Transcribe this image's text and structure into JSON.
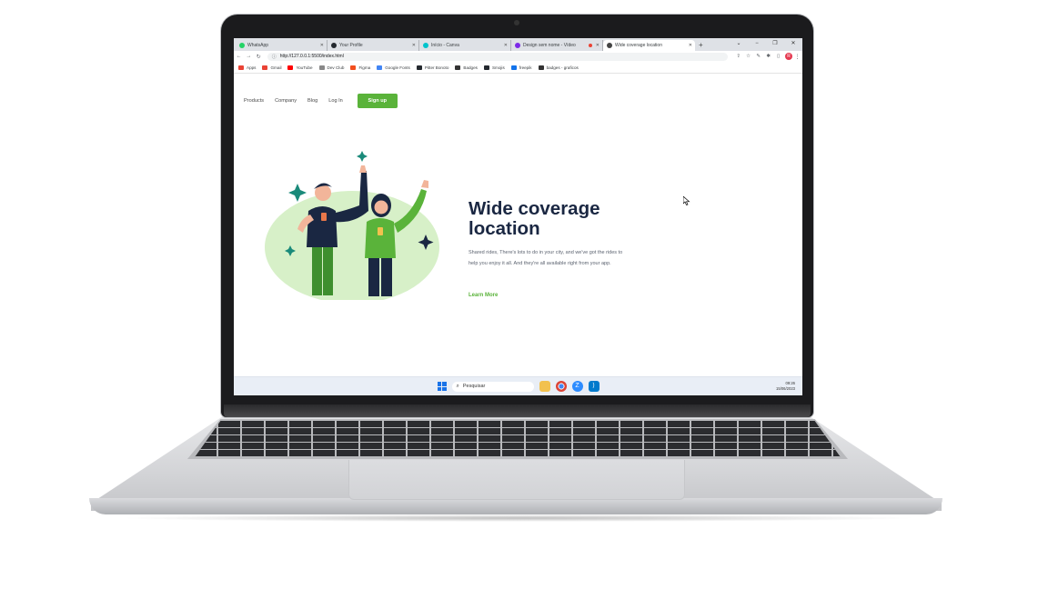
{
  "browser": {
    "tabs": [
      {
        "label": "WhatsApp",
        "favicon_color": "#25d366",
        "active": false
      },
      {
        "label": "Your Profile",
        "favicon_color": "#24292f",
        "active": false
      },
      {
        "label": "Início - Canva",
        "favicon_color": "#00c4cc",
        "active": false
      },
      {
        "label": "Design sem nome - Vídeo",
        "favicon_color": "#7d2ae8",
        "active": false
      },
      {
        "label": "Wide coverage location",
        "favicon_color": "#444444",
        "active": true
      }
    ],
    "new_tab_label": "+",
    "window_controls": {
      "collapse": "⌄",
      "minimize": "−",
      "restore": "❐",
      "close": "✕"
    },
    "nav_buttons": {
      "back": "←",
      "forward": "→",
      "reload": "↻"
    },
    "url": "http://127.0.0.1:5500/index.html",
    "info_icon": "ⓘ",
    "right_icons": [
      "⇪",
      "☆",
      "✎",
      "✱",
      "▯"
    ],
    "profile_initial": "R",
    "bookmarks": [
      {
        "label": "Apps",
        "color": "#ea4335"
      },
      {
        "label": "Gmail",
        "color": "#ea4335"
      },
      {
        "label": "YouTube",
        "color": "#ff0000"
      },
      {
        "label": "Dev Club",
        "color": "#888888"
      },
      {
        "label": "Figma",
        "color": "#f24e1e"
      },
      {
        "label": "Google Fonts",
        "color": "#4285f4"
      },
      {
        "label": "Pitter Bonoto",
        "color": "#24292f"
      },
      {
        "label": "Badges",
        "color": "#333333"
      },
      {
        "label": "Smojis",
        "color": "#24292f"
      },
      {
        "label": "freepik",
        "color": "#1273eb"
      },
      {
        "label": "badges - graficos",
        "color": "#333333"
      }
    ]
  },
  "site": {
    "nav": [
      "Products",
      "Company",
      "Blog",
      "Log In"
    ],
    "signup_label": "Sign up",
    "hero": {
      "title": "Wide coverage location",
      "description": "Shared rides, There's lots to do in your city, and we've got the rides to help you enjoy it all. And they're all available right from your app.",
      "cta": "Learn More"
    },
    "accent_color": "#5ab33a",
    "title_color": "#1a2742"
  },
  "taskbar": {
    "search_placeholder": "Pesquisar",
    "search_icon": "⌕",
    "time": "09:26",
    "date": "15/06/2023"
  }
}
